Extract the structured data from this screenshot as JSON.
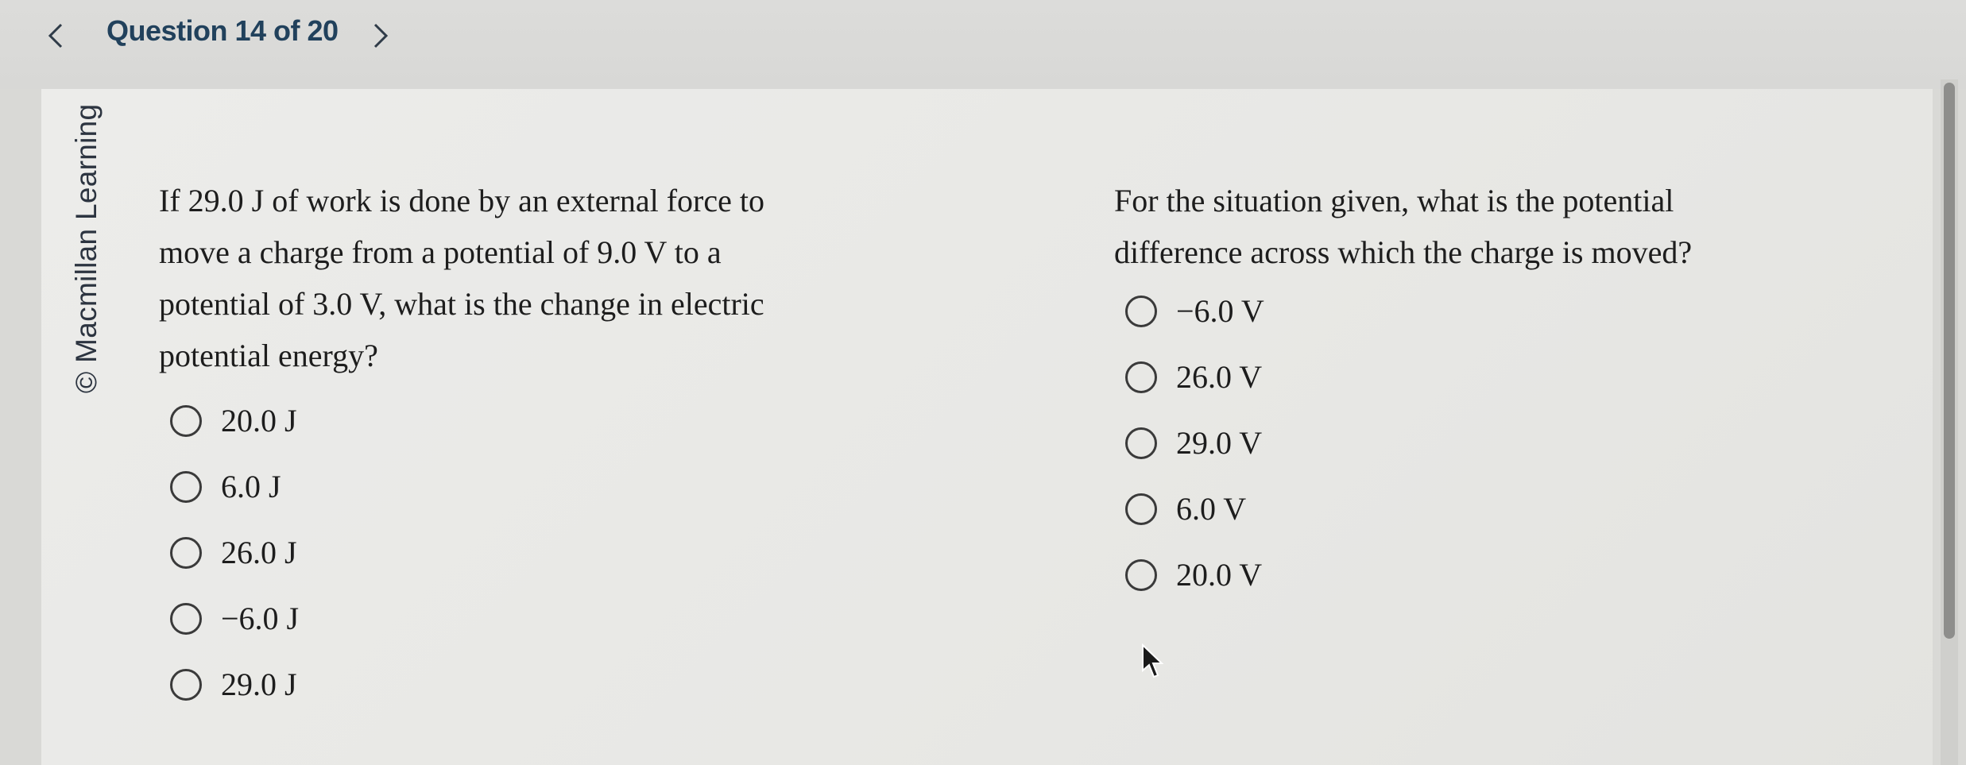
{
  "header": {
    "question_counter": "Question 14 of 20",
    "prev_icon": "chevron-left-icon",
    "next_icon": "chevron-right-icon"
  },
  "sidebar": {
    "copyright": "© Macmillan Learning"
  },
  "question_1": {
    "lines": [
      "If 29.0 J of work is done by an external force to",
      "move a charge from a potential of 9.0 V to a",
      "potential of 3.0 V, what is the change in electric",
      "potential energy?"
    ],
    "options": [
      "20.0 J",
      "6.0 J",
      "26.0 J",
      "−6.0 J",
      "29.0 J"
    ]
  },
  "question_2": {
    "lines": [
      "For the situation given, what is the potential",
      "difference across which the charge is moved?"
    ],
    "options": [
      "−6.0 V",
      "26.0 V",
      "29.0 V",
      "6.0 V",
      "20.0 V"
    ]
  },
  "colors": {
    "accent": "#21415c",
    "text": "#1d1d1d",
    "background": "#ececea"
  }
}
